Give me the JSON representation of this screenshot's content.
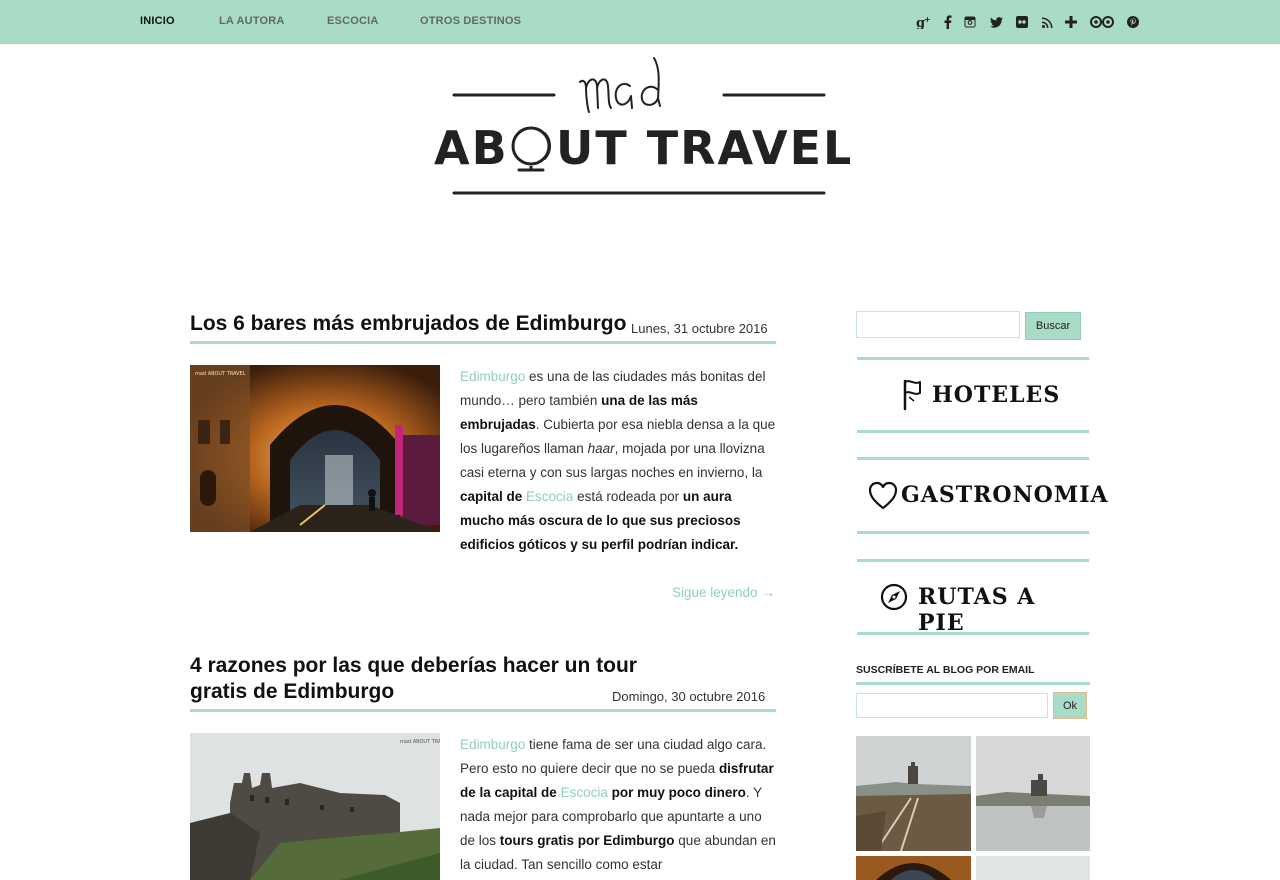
{
  "nav": {
    "items": [
      "INICIO",
      "LA AUTORA",
      "ESCOCIA",
      "OTROS DESTINOS"
    ],
    "social_icons": [
      "google-plus-icon",
      "facebook-icon",
      "instagram-icon",
      "twitter-icon",
      "flickr-icon",
      "rss-icon",
      "bloglovin-icon",
      "tripadvisor-icon",
      "pinterest-icon"
    ]
  },
  "logo": {
    "script": "mad",
    "main": "ABOUT TRAVEL"
  },
  "posts": [
    {
      "title": "Los 6 bares más embrujados de Edimburgo",
      "date": "Lunes, 31 octubre 2016",
      "image_watermark": "mad ABOUT TRAVEL",
      "p1_link": "Edimburgo",
      "p1_a": " es una de las ciudades más bonitas del mundo… pero también ",
      "p1_b": "una de las más embrujadas",
      "p1_c": ". Cubierta por esa niebla densa a la que los lugareños llaman ",
      "p1_i": "haar",
      "p1_d": ", mojada por una llovizna casi eterna y con sus largas noches en invierno, la ",
      "p1_e": "capital de",
      "p1_link2": "Escocia",
      "p1_f": " está rodeada por ",
      "p1_g": "un aura mucho más oscura de lo que sus preciosos edificios góticos y su perfil podrían indicar.",
      "readmore": "Sigue leyendo →"
    },
    {
      "title_line1": "4 razones por las que deberías hacer un tour",
      "title_line2": "gratis de Edimburgo",
      "date": "Domingo, 30 octubre 2016",
      "image_watermark": "mad ABOUT TRAVEL",
      "p1_link": "Edimburgo",
      "p1_a": " tiene fama de ser una ciudad algo cara. Pero esto no quiere decir que no se pueda ",
      "p1_b": "disfrutar de la capital de",
      "p1_link2": "Escocia",
      "p1_c": "por muy poco dinero",
      "p1_d": ". Y nada mejor para comprobarlo que apuntarte a uno de los ",
      "p1_e": "tours gratis por Edimburgo",
      "p1_f": " que abundan en la ciudad. Tan sencillo como estar"
    }
  ],
  "sidebar": {
    "search_button": "Buscar",
    "categories": [
      "HOTELES",
      "GASTRONOMIA",
      "RUTAS A PIE"
    ],
    "category_icons": [
      "flag-icon",
      "heart-icon",
      "compass-icon"
    ],
    "subscribe_title": "SUSCRÍBETE AL BLOG POR EMAIL",
    "subscribe_button": "Ok"
  },
  "colors": {
    "accent": "#a9dcc6",
    "link": "#8fd1b4"
  }
}
